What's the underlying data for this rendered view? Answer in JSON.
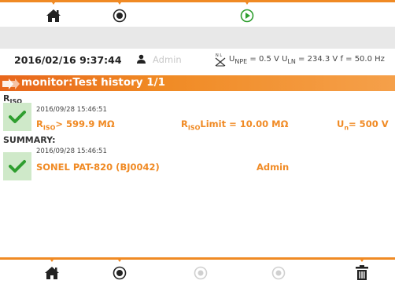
{
  "toolbar_top": {
    "home_icon": "home-icon",
    "record_icon": "circle-dot-icon",
    "play_icon": "play-circle-icon"
  },
  "status": {
    "datetime": "2016/02/16 9:37:44",
    "user": "Admin",
    "npe_label": "U",
    "npe_sub": "NPE",
    "npe_value": "= 0.5 V",
    "ln_label": "U",
    "ln_sub": "LN",
    "ln_value": "= 234.3 V",
    "f_value": "f = 50.0 Hz"
  },
  "title": {
    "text": "monitor:Test history 1/1"
  },
  "riso_section": {
    "label": "R",
    "label_sub": "ISO",
    "date": "2016/09/28 15:46:51",
    "value_label": "R",
    "value_sub": "ISO",
    "value": "> 599.9 MΩ",
    "limit_label": "R",
    "limit_sub": "ISO",
    "limit_value": "Limit = 10.00 MΩ",
    "un_label": "U",
    "un_sub": "n",
    "un_value": "= 500 V"
  },
  "summary_section": {
    "label": "SUMMARY:",
    "date": "2016/09/28 15:46:51",
    "device": "SONEL PAT-820 (BJ0042)",
    "user": "Admin"
  },
  "colors": {
    "accent": "#f08a24",
    "pass_green": "#2f9e2f",
    "pass_bg": "#cfe9c9"
  }
}
